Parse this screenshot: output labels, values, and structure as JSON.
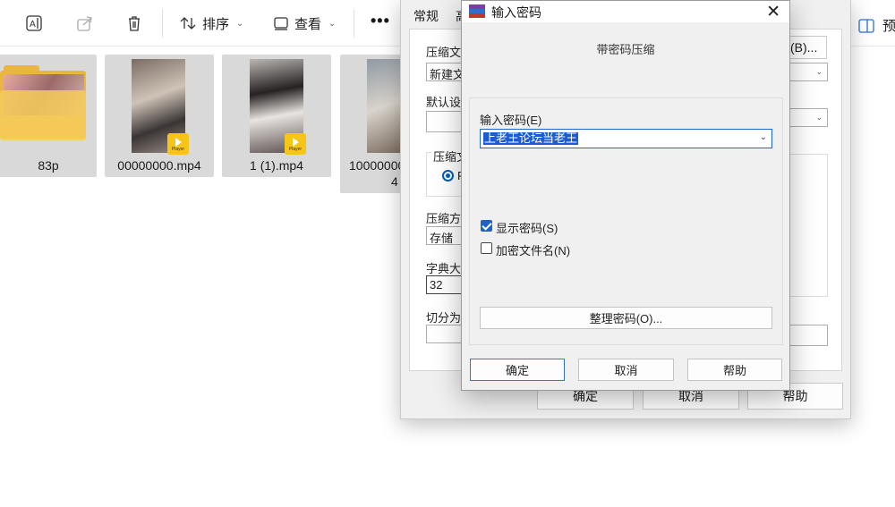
{
  "explorer": {
    "toolbar": {
      "sort_label": "排序",
      "view_label": "查看",
      "more_label": "•••",
      "preview_label": "预"
    },
    "files": [
      {
        "name": "83p",
        "type": "folder"
      },
      {
        "name": "00000000.mp4",
        "type": "video",
        "badge": "Player"
      },
      {
        "name": "1 (1).mp4",
        "type": "video",
        "badge": "Player"
      },
      {
        "name": "10000000",
        "name_line2": "4",
        "type": "video"
      }
    ]
  },
  "archive_dialog": {
    "tabs": [
      "常规",
      "高"
    ],
    "labels": {
      "archive_name": "压缩文",
      "default": "默认设",
      "format_group": "压缩文",
      "method": "压缩方",
      "dict": "字典大",
      "split": "切分为"
    },
    "values": {
      "archive_name": "新建文",
      "method": "存储",
      "dict": "32",
      "radio_option": "F"
    },
    "browse_button": "(B)...",
    "buttons": {
      "ok": "确定",
      "cancel": "取消",
      "help": "帮助"
    }
  },
  "password_dialog": {
    "title": "输入密码",
    "subtitle": "带密码压缩",
    "enter_password_label": "输入密码(E)",
    "password_value": "上老王论坛当老王",
    "show_password_label": "显示密码(S)",
    "show_password_checked": true,
    "encrypt_filenames_label": "加密文件名(N)",
    "encrypt_filenames_checked": false,
    "organize_button": "整理密码(O)...",
    "buttons": {
      "ok": "确定",
      "cancel": "取消",
      "help": "帮助"
    }
  },
  "colors": {
    "selection": "#1c5bd6",
    "checkbox_on": "#1f62c6",
    "folder": "#f7cd5b",
    "player_badge": "#f5c518"
  }
}
